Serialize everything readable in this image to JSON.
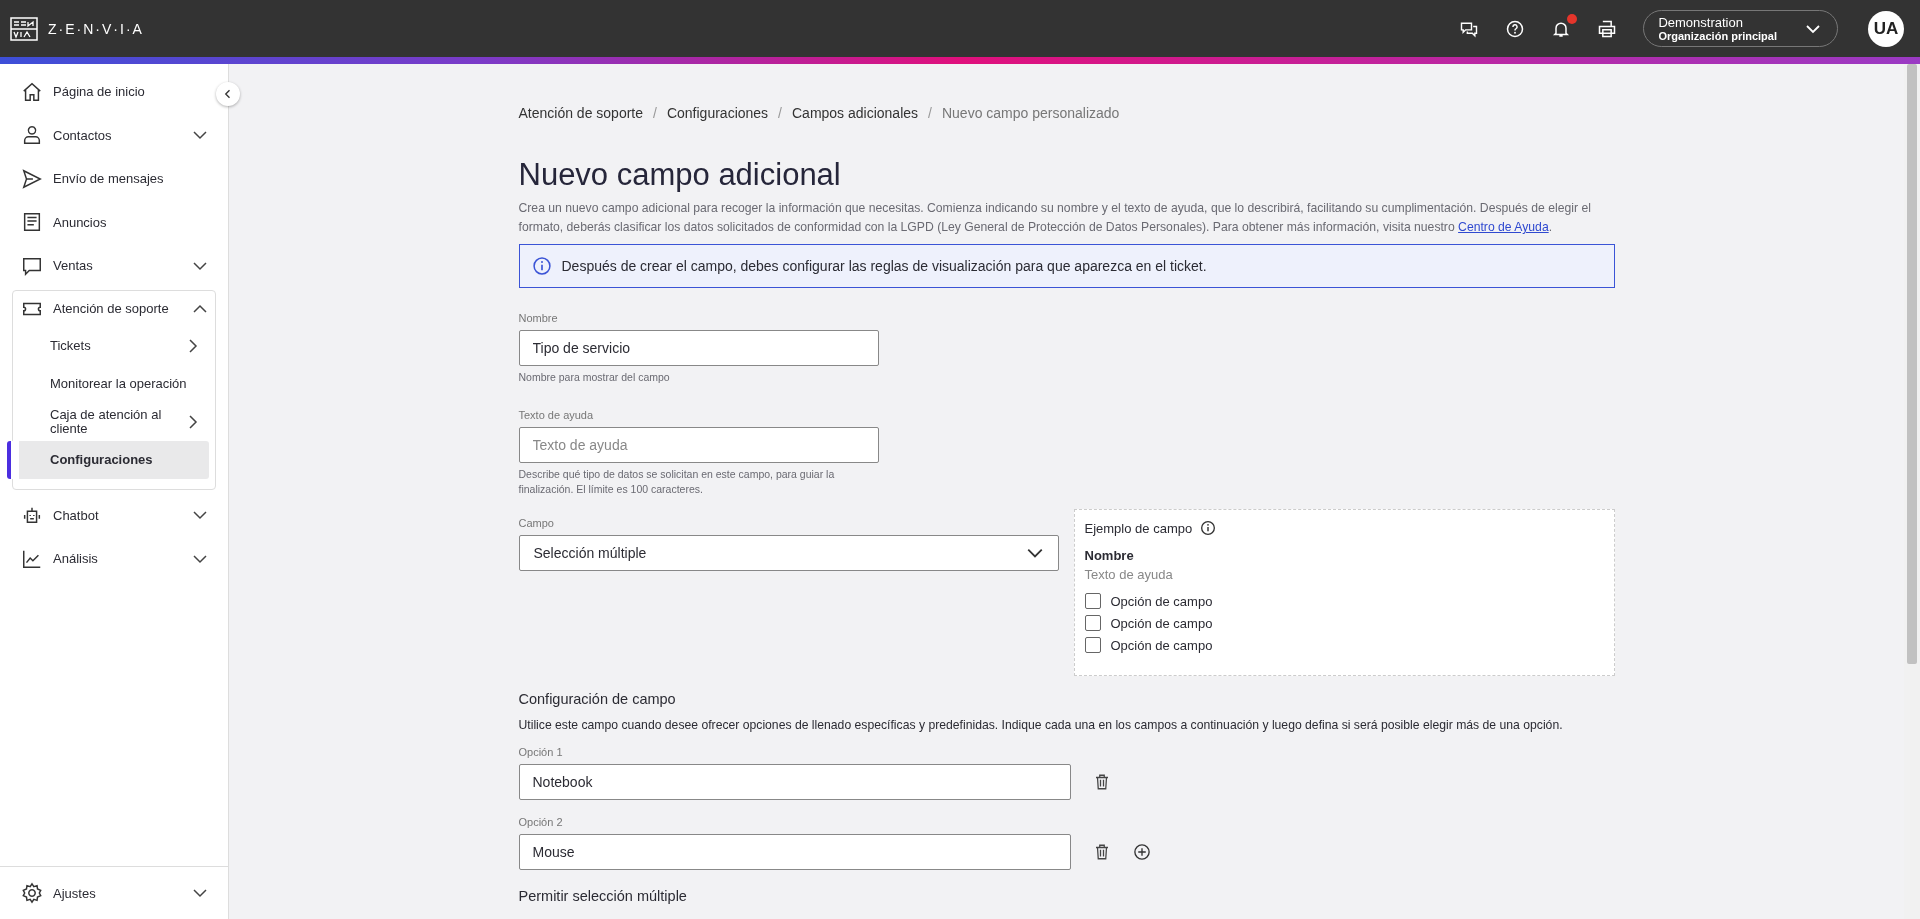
{
  "topbar": {
    "logo_text": "Z·E·N·V·I·A",
    "notification": true,
    "account": {
      "name": "Demonstration",
      "organization": "Organización principal"
    },
    "avatar": "UA"
  },
  "sidebar": {
    "items": [
      {
        "kind": "link",
        "label": "Página de inicio"
      },
      {
        "kind": "group",
        "label": "Contactos",
        "expanded": false
      },
      {
        "kind": "link",
        "label": "Envío de mensajes"
      },
      {
        "kind": "link",
        "label": "Anuncios"
      },
      {
        "kind": "group",
        "label": "Ventas",
        "expanded": false
      },
      {
        "kind": "group",
        "label": "Atención de soporte",
        "expanded": true,
        "children": [
          {
            "label": "Tickets",
            "expandable": true,
            "selected": false
          },
          {
            "label": "Monitorear la operación",
            "expandable": false,
            "selected": false
          },
          {
            "label": "Caja de atención al cliente",
            "expandable": true,
            "selected": false
          },
          {
            "label": "Configuraciones",
            "expandable": false,
            "selected": true
          }
        ]
      },
      {
        "kind": "group",
        "label": "Chatbot",
        "expanded": false
      },
      {
        "kind": "group",
        "label": "Análisis",
        "expanded": false
      }
    ],
    "footer": {
      "label": "Ajustes",
      "expanded": false
    }
  },
  "breadcrumb": [
    {
      "label": "Atención de soporte",
      "current": false
    },
    {
      "separator": "/",
      "label": "Configuraciones",
      "current": false
    },
    {
      "separator": "/",
      "label": "Campos adicionales",
      "current": false
    },
    {
      "separator": "/",
      "label": "Nuevo campo personalizado",
      "current": true
    }
  ],
  "title": "Nuevo campo adicional",
  "description": {
    "text": "Crea un nuevo campo adicional para recoger la información que necesitas. Comienza indicando su nombre y el texto de ayuda, que lo describirá, facilitando su cumplimentación. Después de elegir el formato, deberás clasificar los datos solicitados de conformidad con la LGPD (Ley General de Protección de Datos Personales). Para obtener más información, visita nuestro ",
    "link": "Centro de Ayuda",
    "after": "."
  },
  "info_banner": "Después de crear el campo, debes configurar las reglas de visualización para que aparezca en el ticket.",
  "fields": [
    {
      "label": "Nombre",
      "value": "Tipo de servicio",
      "helper": "Nombre para mostrar del campo"
    },
    {
      "label": "Texto de ayuda",
      "placeholder": "Texto de ayuda",
      "helper": "Describe qué tipo de datos se solicitan en este campo, para guiar la finalización. El límite es 100 caracteres."
    }
  ],
  "campo": {
    "label": "Campo",
    "value": "Selección múltiple"
  },
  "preview": {
    "title": "Ejemplo de campo",
    "name": "Nombre",
    "help": "Texto de ayuda",
    "options": [
      {
        "label": "Opción de campo",
        "checked": false
      },
      {
        "label": "Opción de campo",
        "checked": false
      },
      {
        "label": "Opción de campo",
        "checked": false
      }
    ]
  },
  "config": {
    "title": "Configuración de campo",
    "description": "Utilice este campo cuando desee ofrecer opciones de llenado específicas y predefinidas. Indique cada una en los campos a continuación y luego defina si será posible elegir más de una opción.",
    "options": [
      {
        "label": "Opción 1",
        "value": "Notebook",
        "addable": false
      },
      {
        "label": "Opción 2",
        "value": "Mouse",
        "addable": true
      }
    ],
    "multiple_title": "Permitir selección múltiple"
  }
}
